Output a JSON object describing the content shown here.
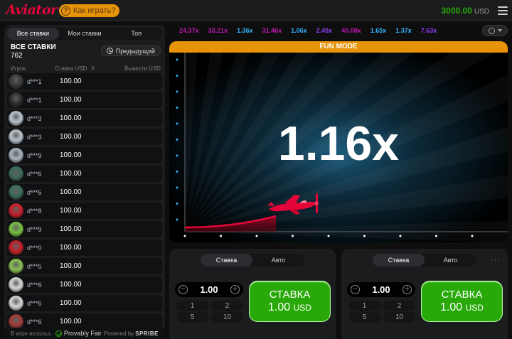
{
  "header": {
    "logo": "Aviator",
    "how_to_play": "Как играть?",
    "balance": "3000.00",
    "currency": "USD"
  },
  "left_panel": {
    "tabs": [
      "Все ставки",
      "Мои ставки",
      "Топ"
    ],
    "title": "ВСЕ СТАВКИ",
    "count": "762",
    "previous_button": "Предыдущий",
    "columns": {
      "player": "Игрок",
      "stake": "Ставка USD",
      "x": "X",
      "cashout": "Вывести USD"
    },
    "rows": [
      {
        "player": "d***1",
        "stake": "100.00",
        "avatar": "#3a3a3a"
      },
      {
        "player": "d***1",
        "stake": "100.00",
        "avatar": "#2e2e2e"
      },
      {
        "player": "d***3",
        "stake": "100.00",
        "avatar": "#b8c4cc"
      },
      {
        "player": "d***3",
        "stake": "100.00",
        "avatar": "#b8c4cc"
      },
      {
        "player": "d***9",
        "stake": "100.00",
        "avatar": "#a9b6c0"
      },
      {
        "player": "d***6",
        "stake": "100.00",
        "avatar": "#3d6a5c"
      },
      {
        "player": "d***6",
        "stake": "100.00",
        "avatar": "#3d6a5c"
      },
      {
        "player": "d***8",
        "stake": "100.00",
        "avatar": "#c8202a"
      },
      {
        "player": "d***9",
        "stake": "100.00",
        "avatar": "#7bc043"
      },
      {
        "player": "d***0",
        "stake": "100.00",
        "avatar": "#c8202a"
      },
      {
        "player": "d***5",
        "stake": "100.00",
        "avatar": "#8cc152"
      },
      {
        "player": "d***6",
        "stake": "100.00",
        "avatar": "#d9d9d9"
      },
      {
        "player": "d***6",
        "stake": "100.00",
        "avatar": "#d9d9d9"
      },
      {
        "player": "d***6",
        "stake": "100.00",
        "avatar": "#a33a3a"
      }
    ],
    "footer": {
      "in_game": "В игре использ.",
      "provably_fair": "Provably Fair",
      "powered_by": "Powered by",
      "brand": "SPRIBE"
    }
  },
  "multipliers": [
    {
      "value": "24.37x",
      "color": "#c017b4"
    },
    {
      "value": "33.21x",
      "color": "#c017b4"
    },
    {
      "value": "1.36x",
      "color": "#34b4ff"
    },
    {
      "value": "31.46x",
      "color": "#c017b4"
    },
    {
      "value": "1.06x",
      "color": "#34b4ff"
    },
    {
      "value": "2.45x",
      "color": "#913ef8"
    },
    {
      "value": "40.08x",
      "color": "#c017b4"
    },
    {
      "value": "1.65x",
      "color": "#34b4ff"
    },
    {
      "value": "1.37x",
      "color": "#34b4ff"
    },
    {
      "value": "7.63x",
      "color": "#913ef8"
    }
  ],
  "game": {
    "mode_banner": "FUN MODE",
    "multiplier": "1.16x"
  },
  "bet_panels": [
    {
      "tabs": [
        "Ставка",
        "Авто"
      ],
      "amount": "1.00",
      "quick": [
        "1",
        "2",
        "5",
        "10"
      ],
      "button_label": "СТАВКА",
      "button_amount": "1.00",
      "button_currency": "USD"
    },
    {
      "tabs": [
        "Ставка",
        "Авто"
      ],
      "amount": "1.00",
      "quick": [
        "1",
        "2",
        "5",
        "10"
      ],
      "button_label": "СТАВКА",
      "button_amount": "1.00",
      "button_currency": "USD",
      "more": "···"
    }
  ],
  "colors": {
    "brand_red": "#e50539",
    "accent_orange": "#e69308",
    "balance_green": "#28a909",
    "bet_green": "#28a909"
  }
}
